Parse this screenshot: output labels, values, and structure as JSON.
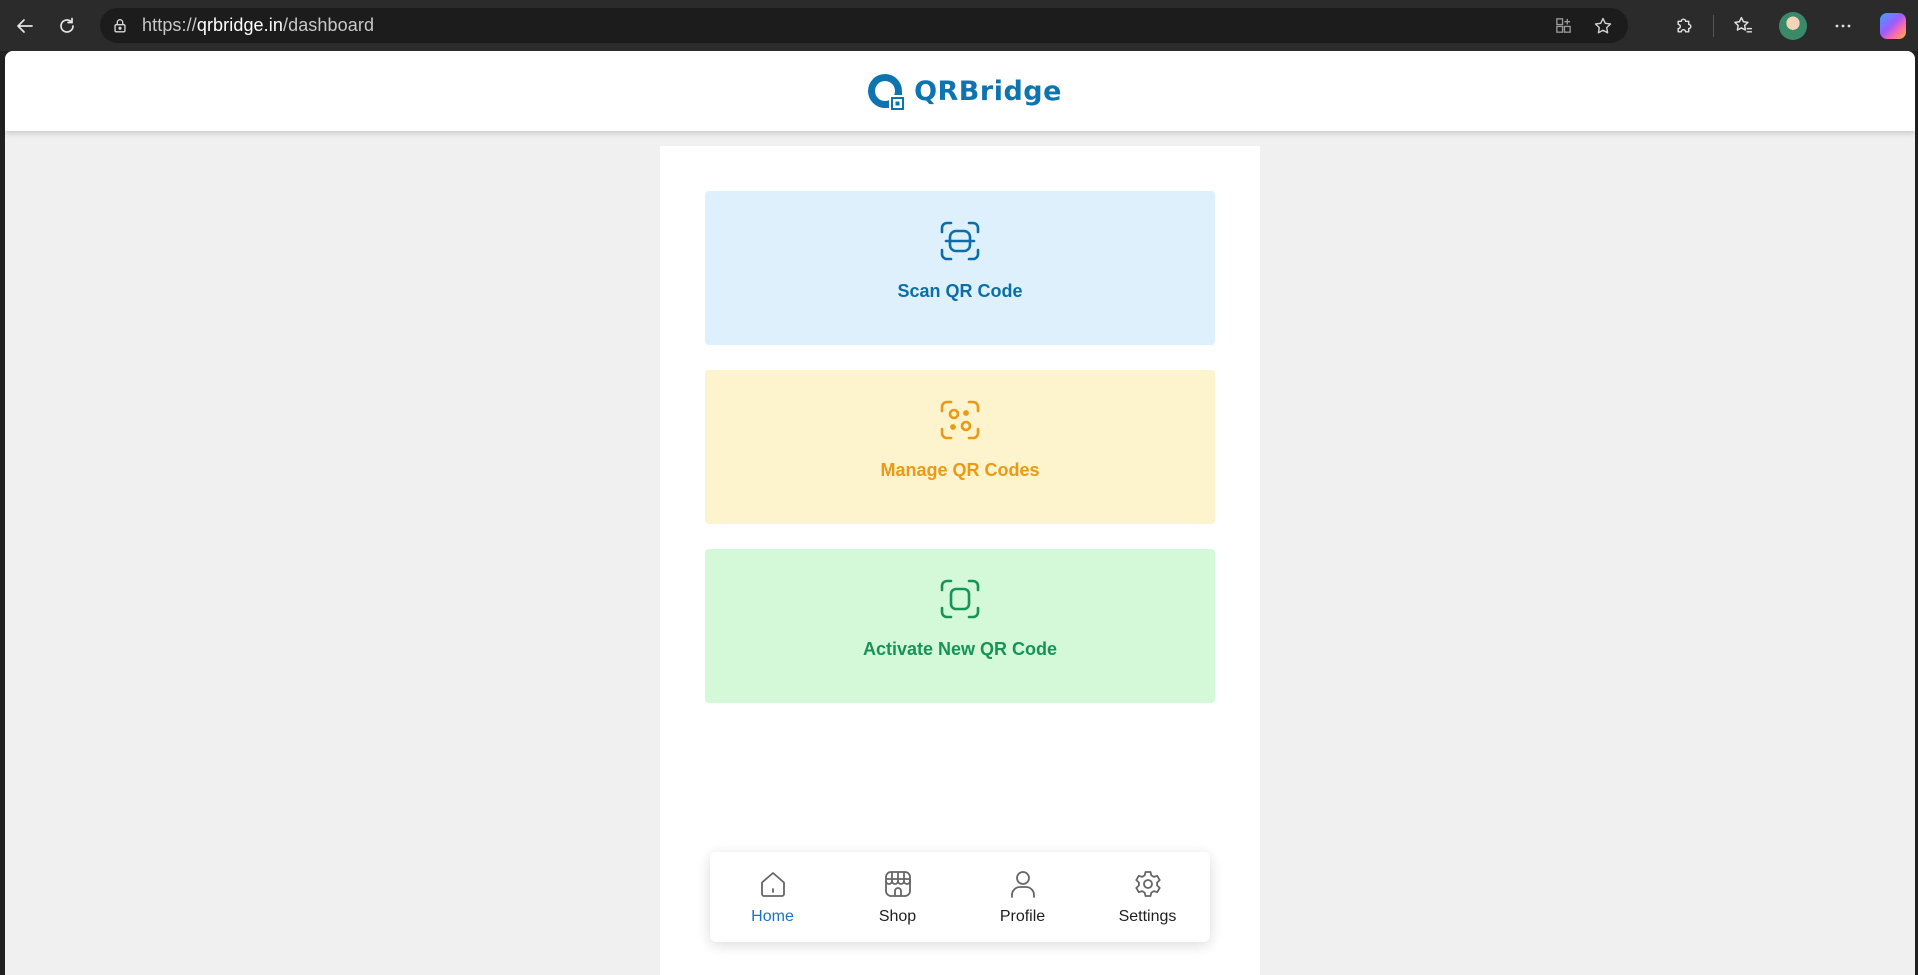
{
  "browser": {
    "url_prefix": "https://",
    "url_host": "qrbridge.in",
    "url_path": "/dashboard"
  },
  "header": {
    "logo_text": "QRBridge"
  },
  "cards": {
    "scan": {
      "label": "Scan QR Code",
      "icon": "scan-icon",
      "color": "#0a6fa8",
      "bg": "#dff0fd"
    },
    "manage": {
      "label": "Manage QR Codes",
      "icon": "qr-manage-icon",
      "color": "#e99a16",
      "bg": "#fdf3cd"
    },
    "activate": {
      "label": "Activate New QR Code",
      "icon": "qr-activate-icon",
      "color": "#17935a",
      "bg": "#d3f9d8"
    }
  },
  "bottom_nav": {
    "items": [
      {
        "label": "Home",
        "icon": "home-icon",
        "active": true
      },
      {
        "label": "Shop",
        "icon": "shop-icon",
        "active": false
      },
      {
        "label": "Profile",
        "icon": "profile-icon",
        "active": false
      },
      {
        "label": "Settings",
        "icon": "settings-icon",
        "active": false
      }
    ],
    "active_color": "#1a73c8"
  },
  "brand_color": "#0d74b0"
}
